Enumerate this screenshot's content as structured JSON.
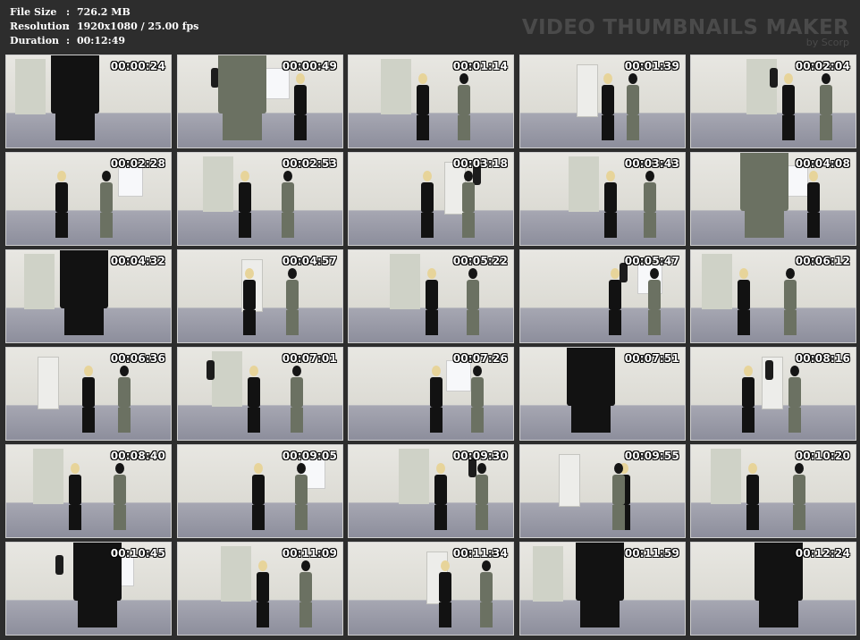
{
  "info": {
    "file_size": {
      "label": "File Size",
      "value": "726.2 MB"
    },
    "resolution": {
      "label": "Resolution",
      "value": "1920x1080 / 25.00 fps"
    },
    "duration": {
      "label": "Duration",
      "value": "00:12:49"
    }
  },
  "brand": {
    "title": "VIDEO THUMBNAILS MAKER",
    "subtitle": "by Scorp"
  },
  "thumbnails": [
    {
      "time": "00:00:24",
      "scene": "closeup"
    },
    {
      "time": "00:00:49",
      "scene": "fight-camo"
    },
    {
      "time": "00:01:14",
      "scene": "duo"
    },
    {
      "time": "00:01:39",
      "scene": "duo-far"
    },
    {
      "time": "00:02:04",
      "scene": "duo"
    },
    {
      "time": "00:02:28",
      "scene": "duo"
    },
    {
      "time": "00:02:53",
      "scene": "duo"
    },
    {
      "time": "00:03:18",
      "scene": "duo"
    },
    {
      "time": "00:03:43",
      "scene": "duo"
    },
    {
      "time": "00:04:08",
      "scene": "fight-camo"
    },
    {
      "time": "00:04:32",
      "scene": "closeup"
    },
    {
      "time": "00:04:57",
      "scene": "duo"
    },
    {
      "time": "00:05:22",
      "scene": "duo"
    },
    {
      "time": "00:05:47",
      "scene": "duo"
    },
    {
      "time": "00:06:12",
      "scene": "duo"
    },
    {
      "time": "00:06:36",
      "scene": "duo-far"
    },
    {
      "time": "00:07:01",
      "scene": "duo"
    },
    {
      "time": "00:07:26",
      "scene": "duo"
    },
    {
      "time": "00:07:51",
      "scene": "closeup"
    },
    {
      "time": "00:08:16",
      "scene": "duo"
    },
    {
      "time": "00:08:40",
      "scene": "duo"
    },
    {
      "time": "00:09:05",
      "scene": "duo"
    },
    {
      "time": "00:09:30",
      "scene": "duo"
    },
    {
      "time": "00:09:55",
      "scene": "duo"
    },
    {
      "time": "00:10:20",
      "scene": "duo"
    },
    {
      "time": "00:10:45",
      "scene": "closeup"
    },
    {
      "time": "00:11:09",
      "scene": "duo"
    },
    {
      "time": "00:11:34",
      "scene": "duo"
    },
    {
      "time": "00:11:59",
      "scene": "closeup"
    },
    {
      "time": "00:12:24",
      "scene": "closeup"
    }
  ],
  "colors": {
    "background": "#2d2d2d",
    "header_text": "#ffffff",
    "brand_text": "#4a4a4a"
  }
}
